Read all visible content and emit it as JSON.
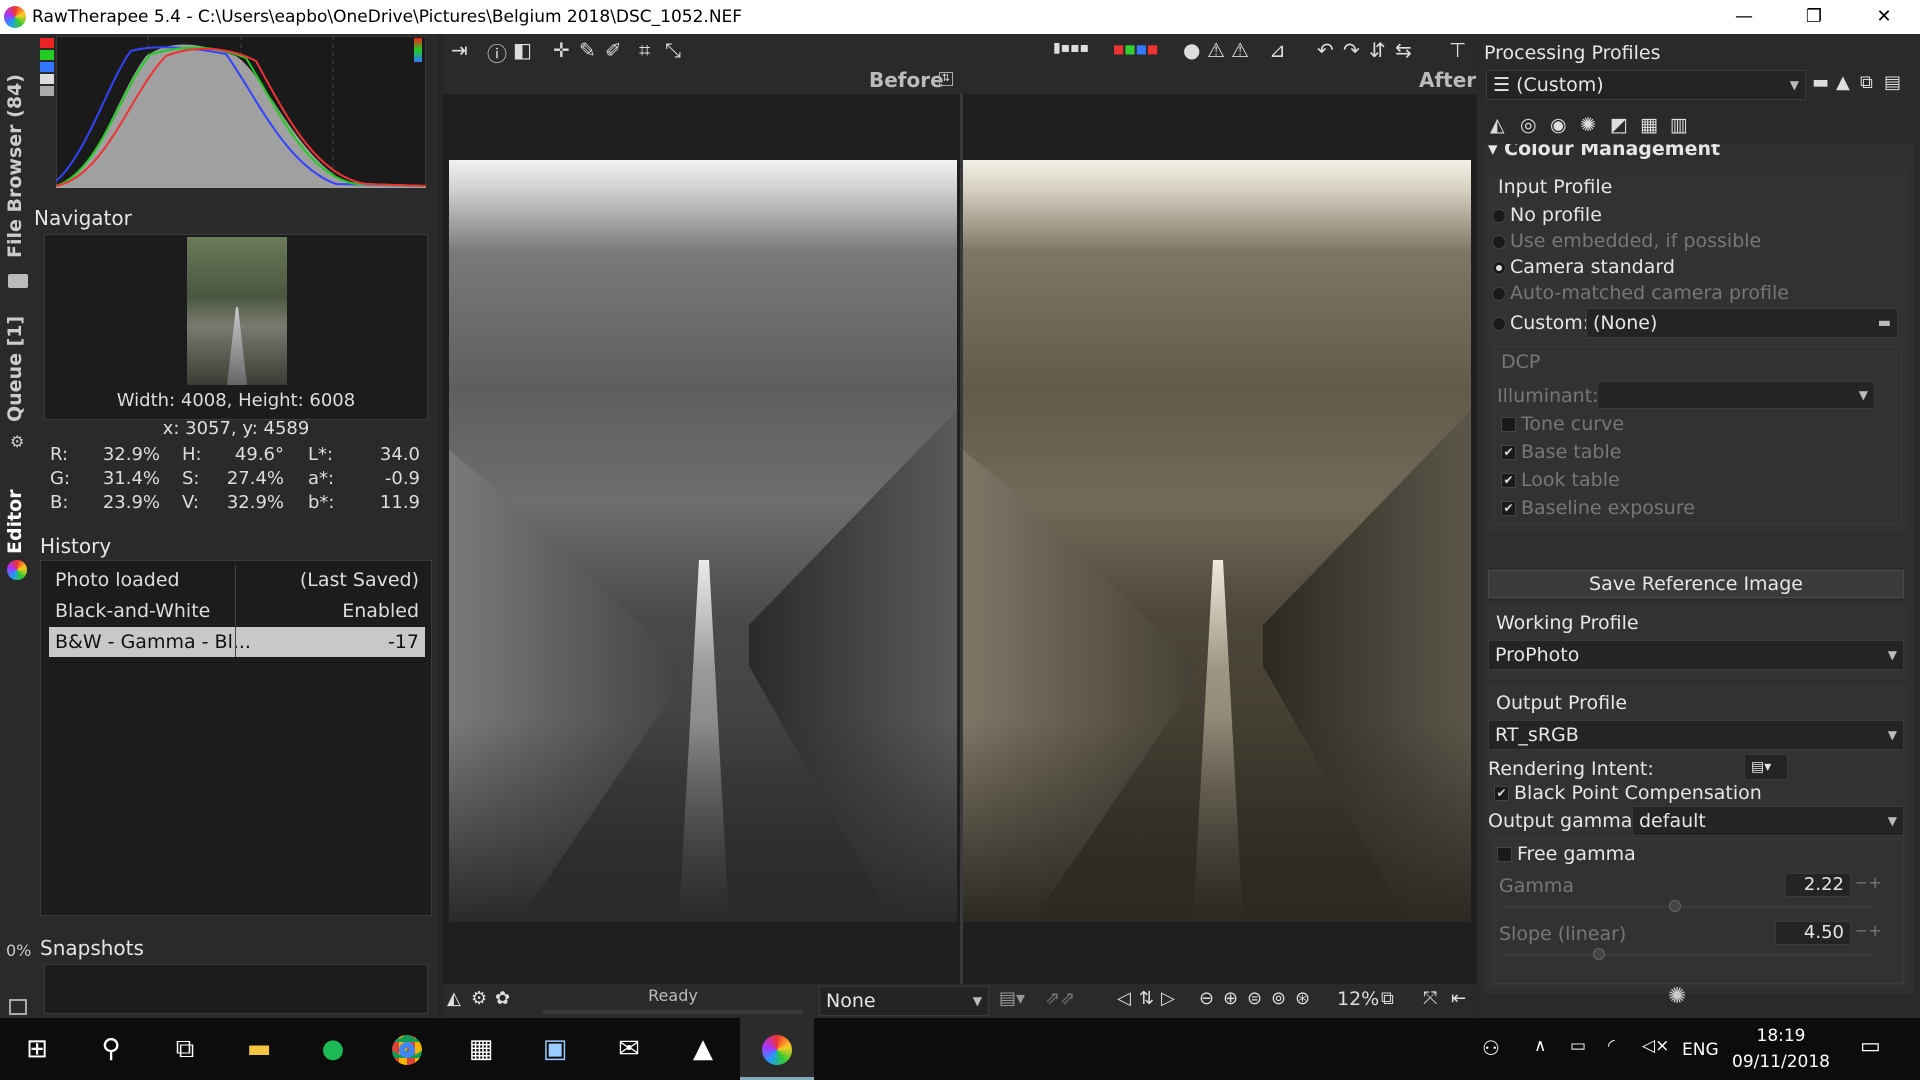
{
  "window": {
    "title": "RawTherapee 5.4 - C:\\Users\\eapbo\\OneDrive\\Pictures\\Belgium 2018\\DSC_1052.NEF",
    "min": "—",
    "max": "❐",
    "close": "✕"
  },
  "vtabs": {
    "file_browser": "File Browser (84)",
    "queue": "Queue [1]",
    "editor": "Editor",
    "progress": "0%"
  },
  "navigator": {
    "title": "Navigator",
    "size": "Width: 4008, Height: 6008",
    "coords": "x: 3057, y: 4589",
    "r": "R:",
    "r_val": "32.9%",
    "g": "G:",
    "g_val": "31.4%",
    "b": "B:",
    "b_val": "23.9%",
    "h": "H:",
    "h_val": "49.6°",
    "s": "S:",
    "s_val": "27.4%",
    "v": "V:",
    "v_val": "32.9%",
    "l": "L*:",
    "l_val": "34.0",
    "a": "a*:",
    "a_val": "-0.9",
    "bb": "b*:",
    "bb_val": "11.9"
  },
  "history": {
    "title": "History",
    "rows": [
      {
        "name": "Photo loaded",
        "value": "(Last Saved)"
      },
      {
        "name": "Black-and-White",
        "value": "Enabled"
      },
      {
        "name": "B&W - Gamma - Bl...",
        "value": "-17"
      }
    ]
  },
  "snapshots": {
    "title": "Snapshots",
    "add": "+",
    "remove": "−"
  },
  "preview": {
    "before": "Before",
    "after": "After"
  },
  "statusbar": {
    "status": "Ready",
    "preset": "None",
    "zoom": "12%"
  },
  "right": {
    "profiles_title": "Processing Profiles",
    "profile_value": "(Custom)",
    "section": "Colour Management",
    "input_profile": "Input Profile",
    "opt_none": "No profile",
    "opt_embedded": "Use embedded, if possible",
    "opt_camera": "Camera standard",
    "opt_auto": "Auto-matched camera profile",
    "opt_custom": "Custom:",
    "custom_value": "(None)",
    "dcp": "DCP",
    "illuminant": "Illuminant:",
    "tone_curve": "Tone curve",
    "base_table": "Base table",
    "look_table": "Look table",
    "baseline": "Baseline exposure",
    "save_ref": "Save Reference Image",
    "working_profile": "Working Profile",
    "working_value": "ProPhoto",
    "output_profile": "Output Profile",
    "output_value": "RT_sRGB",
    "rendering_intent": "Rendering Intent:",
    "bpc": "Black Point Compensation",
    "output_gamma": "Output gamma:",
    "output_gamma_value": "default",
    "free_gamma": "Free gamma",
    "gamma": "Gamma",
    "gamma_value": "2.22",
    "slope": "Slope (linear)",
    "slope_value": "4.50"
  },
  "taskbar": {
    "lang": "ENG",
    "time": "18:19",
    "date": "09/11/2018"
  }
}
